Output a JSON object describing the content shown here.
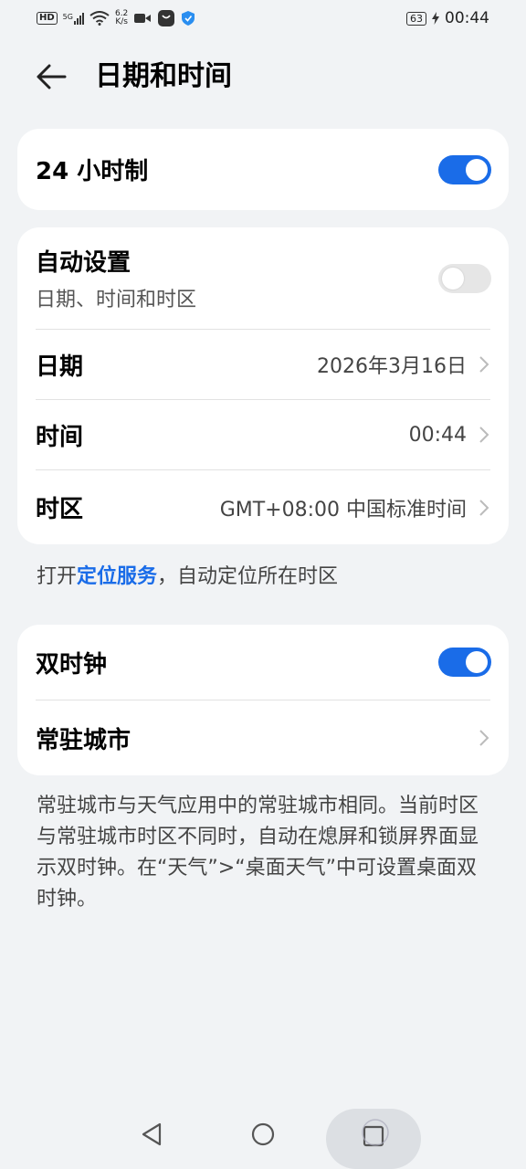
{
  "status_bar": {
    "hd": "HD",
    "signal": "5G",
    "net_speed_value": "6.2",
    "net_speed_unit": "K/s",
    "battery": "63",
    "time": "00:44"
  },
  "header": {
    "title": "日期和时间"
  },
  "card_24h": {
    "label": "24 小时制",
    "toggle_on": true
  },
  "card_auto": {
    "auto_label": "自动设置",
    "auto_sub": "日期、时间和时区",
    "auto_toggle_on": false,
    "date_label": "日期",
    "date_value": "2026年3月16日",
    "time_label": "时间",
    "time_value": "00:44",
    "zone_label": "时区",
    "zone_value": "GMT+08:00 中国标准时间"
  },
  "location_hint": {
    "prefix": "打开",
    "link": "定位服务",
    "suffix": "，自动定位所在时区"
  },
  "card_dual": {
    "dual_label": "双时钟",
    "dual_toggle_on": true,
    "city_label": "常驻城市"
  },
  "dual_description": "常驻城市与天气应用中的常驻城市相同。当前时区与常驻城市时区不同时，自动在熄屏和锁屏界面显示双时钟。在“天气”>“桌面天气”中可设置桌面双时钟。",
  "colors": {
    "accent": "#1a6ce8",
    "background": "#f1f3f5",
    "card": "#ffffff"
  }
}
